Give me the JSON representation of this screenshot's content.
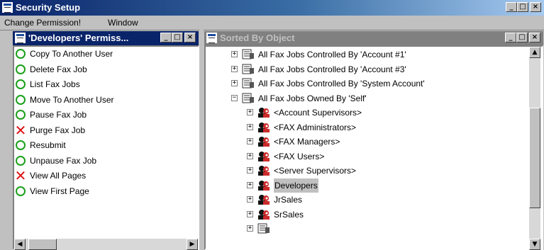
{
  "window": {
    "title": "Security Setup"
  },
  "menu": {
    "items": [
      "Change Permission!",
      "Window"
    ]
  },
  "permissions_pane": {
    "title": "'Developers' Permiss...",
    "items": [
      {
        "label": "Copy To Another User",
        "status": "allowed"
      },
      {
        "label": "Delete Fax Job",
        "status": "allowed"
      },
      {
        "label": "List Fax Jobs",
        "status": "allowed"
      },
      {
        "label": "Move To Another User",
        "status": "allowed"
      },
      {
        "label": "Pause Fax Job",
        "status": "allowed"
      },
      {
        "label": "Purge Fax Job",
        "status": "denied"
      },
      {
        "label": "Resubmit",
        "status": "allowed"
      },
      {
        "label": "Unpause Fax Job",
        "status": "allowed"
      },
      {
        "label": "View All Pages",
        "status": "denied"
      },
      {
        "label": "View First Page",
        "status": "allowed"
      }
    ]
  },
  "object_pane": {
    "title": "Sorted By Object",
    "tree": [
      {
        "label": "All Fax Jobs Controlled By 'Account #1'",
        "level": 0,
        "expanded": false,
        "icon": "fax-jobs-icon"
      },
      {
        "label": "All Fax Jobs Controlled By 'Account #3'",
        "level": 0,
        "expanded": false,
        "icon": "fax-jobs-icon"
      },
      {
        "label": "All Fax Jobs Controlled By 'System Account'",
        "level": 0,
        "expanded": false,
        "icon": "fax-jobs-icon"
      },
      {
        "label": "All Fax Jobs Owned By 'Self'",
        "level": 0,
        "expanded": true,
        "icon": "fax-jobs-icon"
      },
      {
        "label": "<Account Supervisors>",
        "level": 1,
        "expanded": false,
        "icon": "user-group-icon"
      },
      {
        "label": "<FAX Administrators>",
        "level": 1,
        "expanded": false,
        "icon": "user-group-icon"
      },
      {
        "label": "<FAX Managers>",
        "level": 1,
        "expanded": false,
        "icon": "user-group-icon"
      },
      {
        "label": "<FAX Users>",
        "level": 1,
        "expanded": false,
        "icon": "user-group-icon"
      },
      {
        "label": "<Server Supervisors>",
        "level": 1,
        "expanded": false,
        "icon": "user-group-icon"
      },
      {
        "label": "Developers",
        "level": 1,
        "expanded": false,
        "icon": "user-group-icon",
        "selected": true
      },
      {
        "label": "JrSales",
        "level": 1,
        "expanded": false,
        "icon": "user-group-icon"
      },
      {
        "label": "SrSales",
        "level": 1,
        "expanded": false,
        "icon": "user-group-icon"
      },
      {
        "label": "",
        "level": 1,
        "expanded": false,
        "icon": "fax-jobs-icon"
      }
    ]
  },
  "colors": {
    "allowed": "#1aa01a",
    "denied": "#e01010",
    "title_active": "#0a246a",
    "title_inactive": "#808080"
  }
}
